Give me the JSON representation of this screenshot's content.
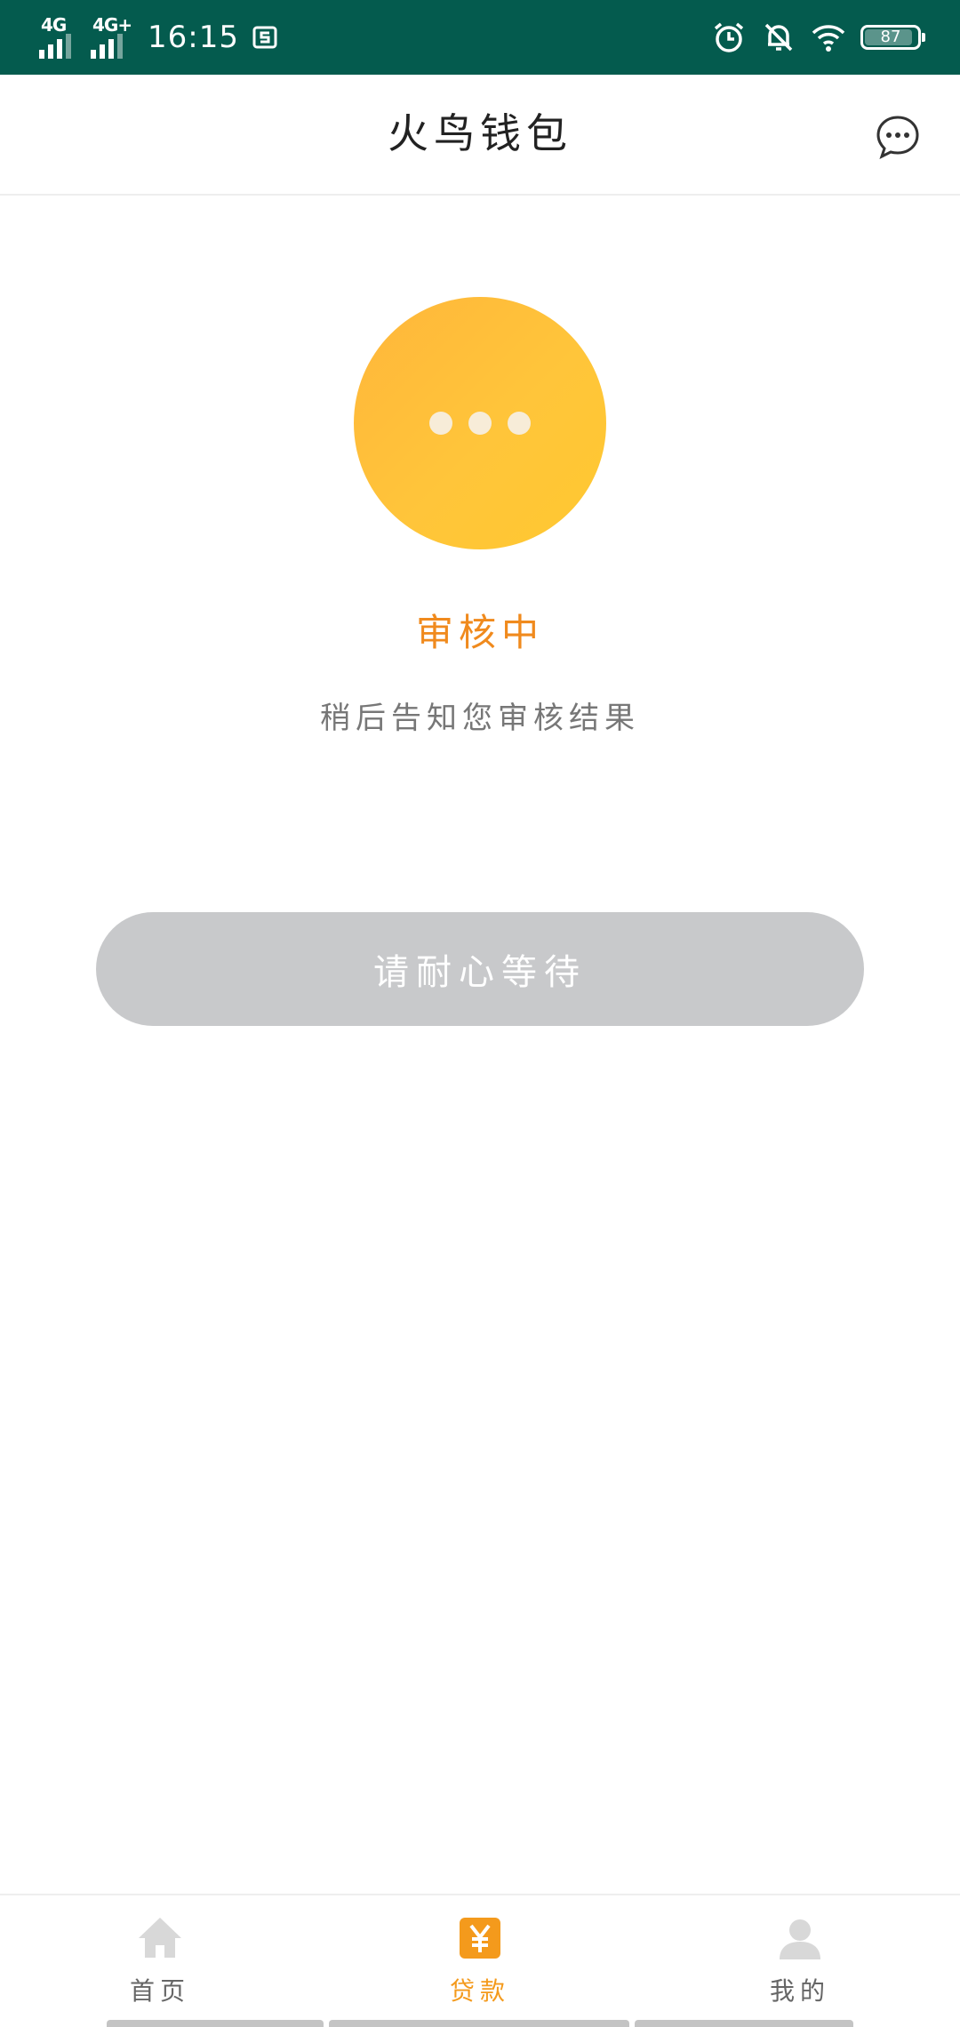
{
  "status_bar": {
    "network_1": "4G",
    "network_2": "4G+",
    "time": "16:15",
    "battery_level": "87",
    "icons": [
      "signal-icon",
      "screenshot-icon",
      "alarm-icon",
      "mute-bell-icon",
      "wifi-icon",
      "battery-icon"
    ]
  },
  "header": {
    "title": "火鸟钱包",
    "action_icon": "chat-bubble-icon"
  },
  "review": {
    "indicator_icon": "pending-dots-icon",
    "status_title": "审核中",
    "status_message": "稍后告知您审核结果",
    "wait_button_label": "请耐心等待"
  },
  "tabbar": {
    "items": [
      {
        "label": "首页",
        "icon": "home-icon",
        "active": false
      },
      {
        "label": "贷款",
        "icon": "yuan-icon",
        "active": true
      },
      {
        "label": "我的",
        "icon": "user-icon",
        "active": false
      }
    ]
  },
  "colors": {
    "status_bar_bg": "#045b4e",
    "accent": "#f49a1c",
    "status_title": "#f08a1d",
    "circle": "#ffc03a",
    "button_disabled": "#c8c9cb"
  }
}
